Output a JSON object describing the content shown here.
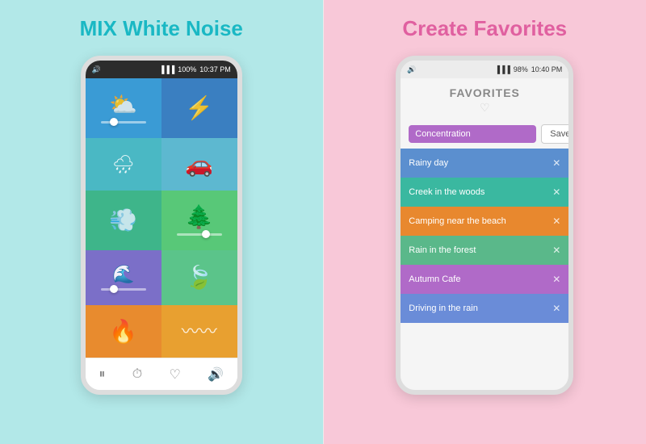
{
  "left": {
    "title": "MIX White Noise",
    "phone": {
      "status_bar": {
        "left_icon": "🔊",
        "signal": "📶",
        "battery": "100%",
        "time": "10:37 PM"
      },
      "grid": [
        {
          "id": "thunder-cloud",
          "icon": "⛅",
          "color_class": "c-thunder-left",
          "has_slider": true,
          "slider_pos": "left"
        },
        {
          "id": "lightning",
          "icon": "⚡",
          "color_class": "c-thunder-right",
          "has_slider": false
        },
        {
          "id": "rain-window",
          "icon": "🌧",
          "color_class": "c-rain-left",
          "has_slider": false
        },
        {
          "id": "car",
          "icon": "🚗",
          "color_class": "c-rain-right",
          "has_slider": false
        },
        {
          "id": "wind",
          "icon": "💨",
          "color_class": "c-wind-left",
          "has_slider": false
        },
        {
          "id": "tree",
          "icon": "🌲",
          "color_class": "c-wind-right",
          "has_slider": true,
          "slider_pos": "right"
        },
        {
          "id": "water",
          "icon": "🌊",
          "color_class": "c-water-left",
          "has_slider": true,
          "slider_pos": "left"
        },
        {
          "id": "leaf",
          "icon": "🍃",
          "color_class": "c-water-right",
          "has_slider": false
        },
        {
          "id": "fire",
          "icon": "🔥",
          "color_class": "c-fire-left",
          "has_slider": false
        },
        {
          "id": "waves",
          "icon": "〰",
          "color_class": "c-fire-right",
          "has_slider": false
        }
      ],
      "nav": [
        "⏸",
        "⏱",
        "♡",
        "🔊"
      ]
    }
  },
  "right": {
    "title": "Create Favorites",
    "phone": {
      "status_bar": {
        "left_icon": "🔊",
        "signal": "📶",
        "battery": "98%",
        "time": "10:40 PM"
      },
      "favorites_title": "FAVORITES",
      "heart_icon": "♡",
      "input_placeholder": "Concentration",
      "save_button": "Save",
      "items": [
        {
          "label": "Rainy day",
          "color_class": "fav-rainy"
        },
        {
          "label": "Creek in the woods",
          "color_class": "fav-creek"
        },
        {
          "label": "Camping near the beach",
          "color_class": "fav-camping"
        },
        {
          "label": "Rain in the forest",
          "color_class": "fav-forest"
        },
        {
          "label": "Autumn Cafe",
          "color_class": "fav-autumn"
        },
        {
          "label": "Driving in the rain",
          "color_class": "fav-driving"
        }
      ],
      "close_icon": "✕"
    }
  }
}
